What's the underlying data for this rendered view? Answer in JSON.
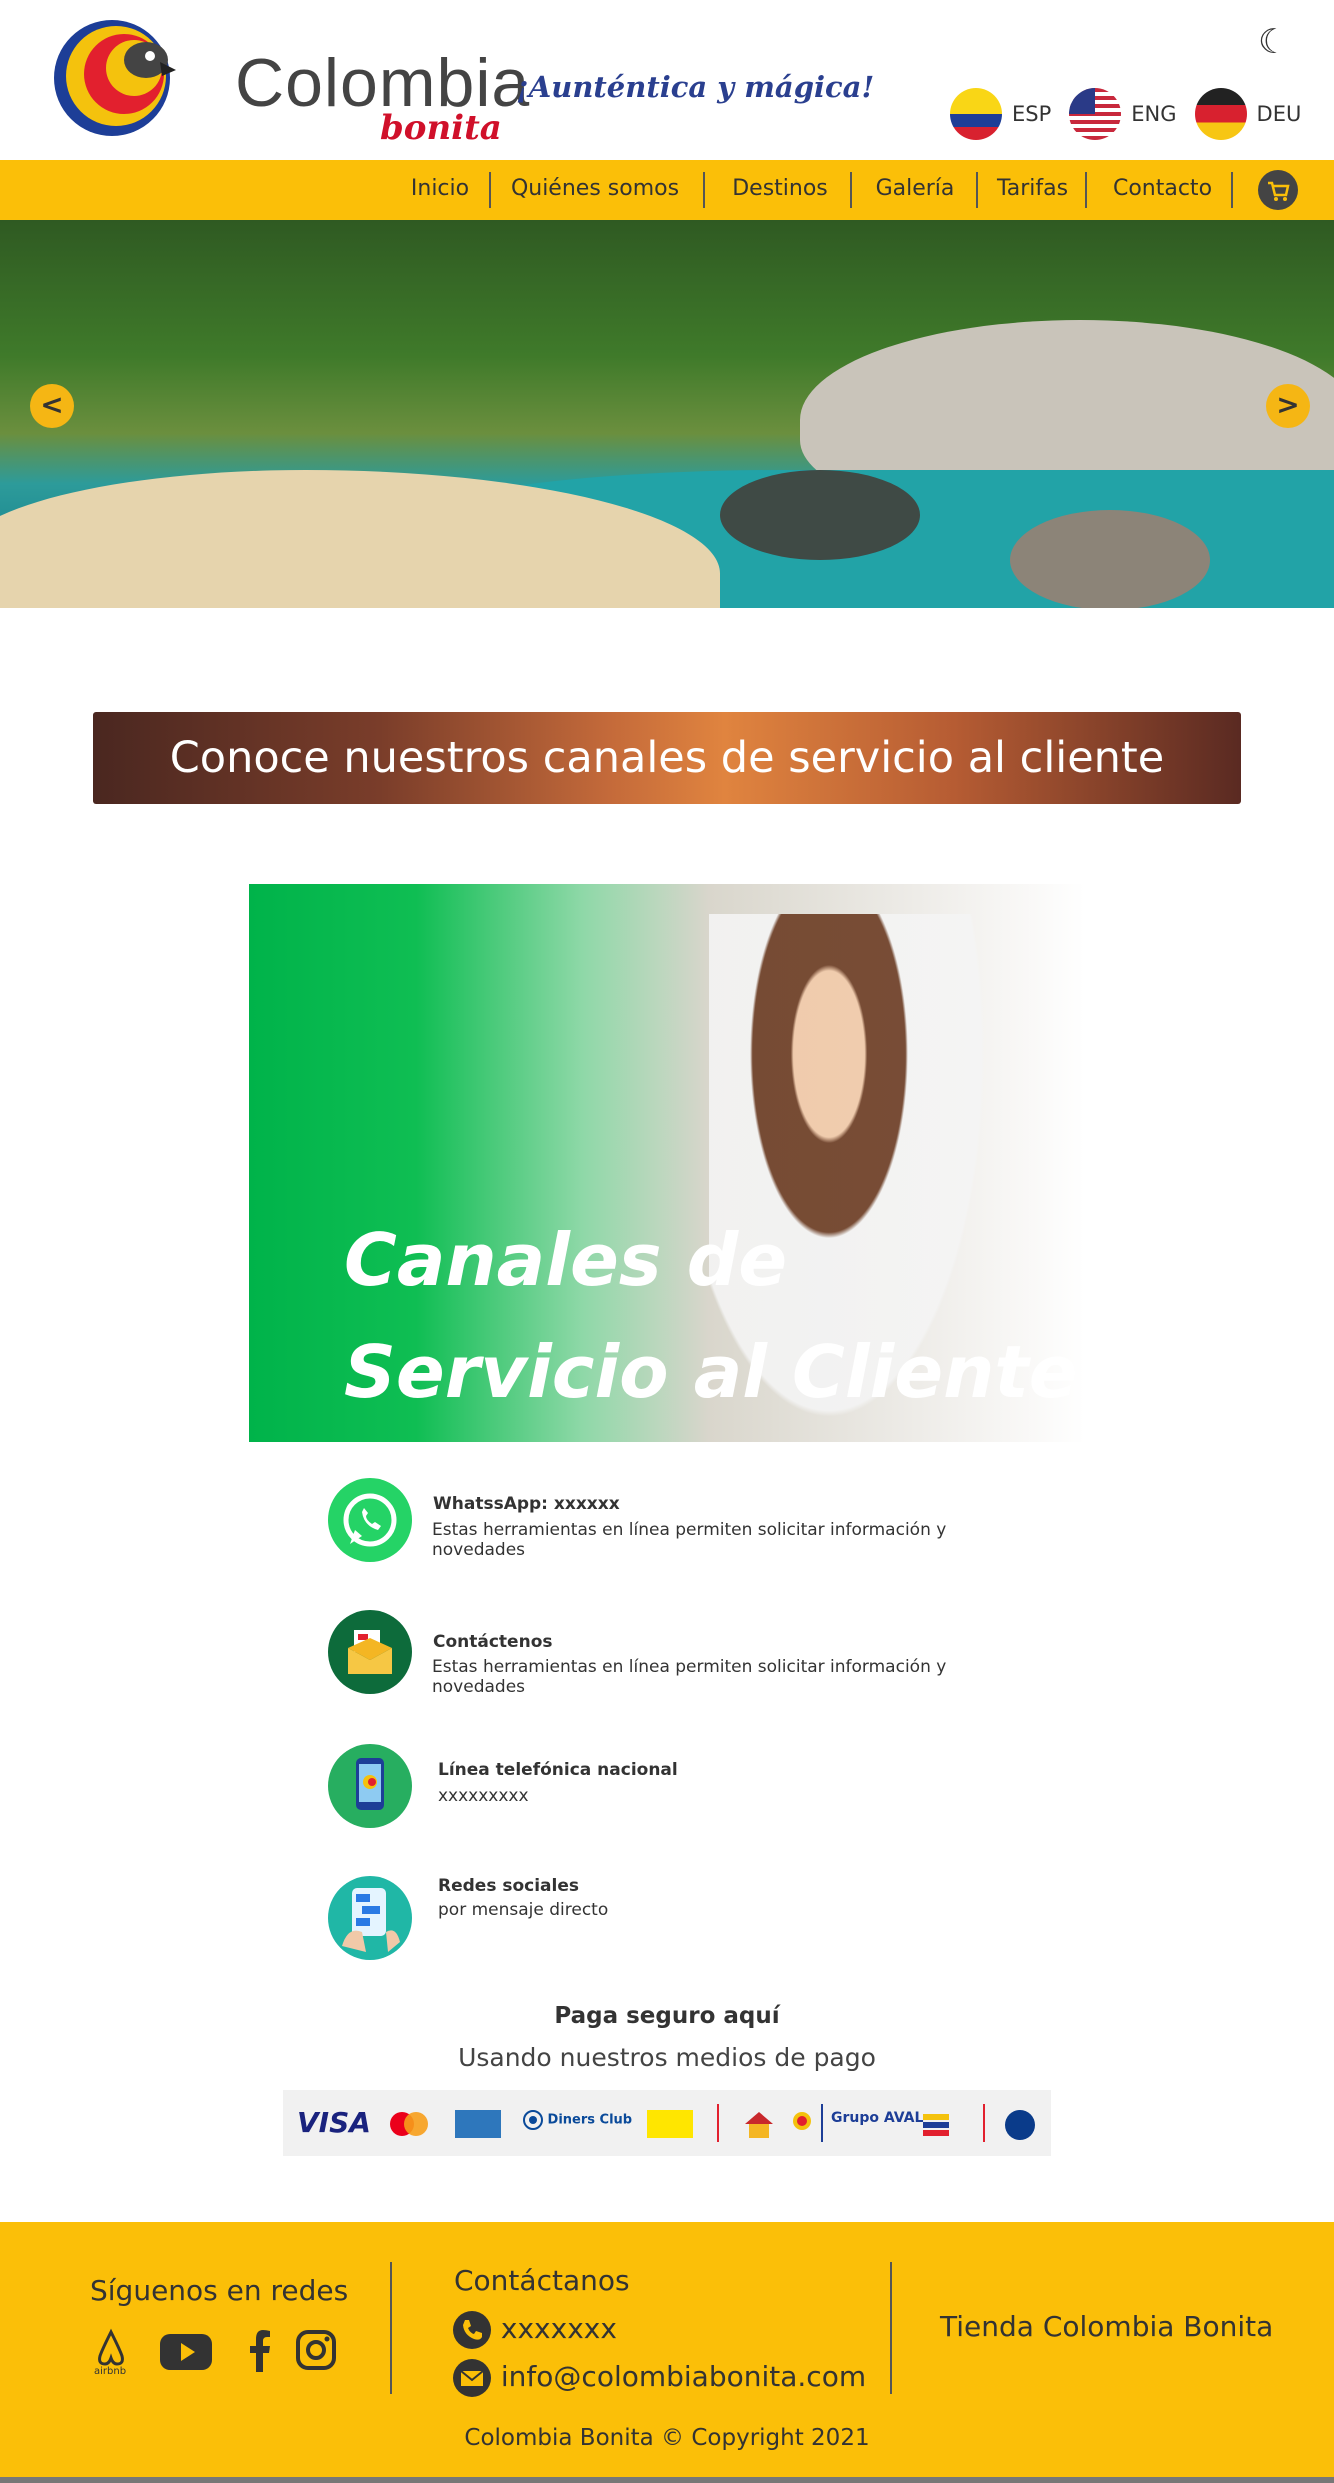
{
  "header": {
    "logo_main": "Colombia",
    "logo_sub": "bonita",
    "tagline": "¡Aunténtica y mágica!",
    "theme_icon": "moon-icon",
    "languages": [
      {
        "code": "ESP",
        "flag": "colombia-flag-icon"
      },
      {
        "code": "ENG",
        "flag": "usa-flag-icon"
      },
      {
        "code": "DEU",
        "flag": "germany-flag-icon"
      }
    ]
  },
  "nav": {
    "items": [
      "Inicio",
      "Quiénes somos",
      "Destinos",
      "Galería",
      "Tarifas",
      "Contacto"
    ],
    "cart_icon": "cart-icon",
    "accent": "#fbbf08"
  },
  "hero": {
    "prev_label": "<",
    "next_label": ">"
  },
  "banner": {
    "title": "Conoce nuestros canales de servicio al cliente"
  },
  "service_image": {
    "title_line1": "Canales de",
    "title_line2": "Servicio al Cliente"
  },
  "channels": [
    {
      "title": "WhatssApp: xxxxxx",
      "desc": "Estas herramientas en línea permiten solicitar información y novedades",
      "icon": "whatsapp-icon"
    },
    {
      "title": "Contáctenos",
      "desc": "Estas herramientas en línea permiten solicitar información y novedades",
      "icon": "mail-icon"
    },
    {
      "title": "Línea telefónica nacional",
      "desc": "xxxxxxxxx",
      "icon": "phone-icon"
    },
    {
      "title": "Redes sociales",
      "desc": "por mensaje directo",
      "icon": "social-chat-icon"
    }
  ],
  "payment": {
    "title": "Paga seguro aquí",
    "subtitle": "Usando nuestros medios de pago",
    "logos": [
      "VISA",
      "Diners Club",
      "Grupo AVAL"
    ]
  },
  "footer": {
    "social_title": "Síguenos en redes",
    "contact_title": "Contáctanos",
    "phone": "xxxxxxx",
    "email": "info@colombiabonita.com",
    "store": "Tienda Colombia Bonita",
    "copyright": "Colombia Bonita © Copyright 2021"
  }
}
